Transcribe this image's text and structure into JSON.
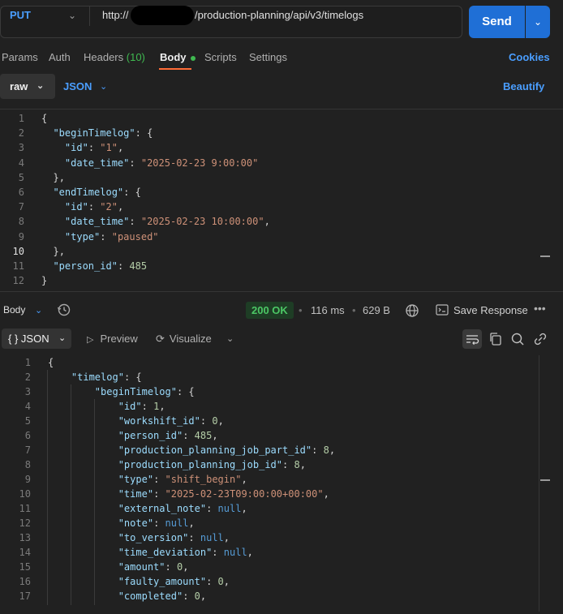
{
  "request": {
    "method": "PUT",
    "url_prefix": "http://",
    "url_path": "/production-planning/api/v3/timelogs",
    "send_label": "Send"
  },
  "request_tabs": {
    "params": "Params",
    "auth": "Auth",
    "headers": "Headers",
    "headers_count": "(10)",
    "body": "Body",
    "scripts": "Scripts",
    "settings": "Settings",
    "cookies": "Cookies"
  },
  "body_options": {
    "mode": "raw",
    "language": "JSON",
    "beautify": "Beautify"
  },
  "request_body_lines": [
    "{",
    "  \"beginTimelog\": {",
    "    \"id\": \"1\",",
    "    \"date_time\": \"2025-02-23 9:00:00\"",
    "  },",
    "  \"endTimelog\": {",
    "    \"id\": \"2\",",
    "    \"date_time\": \"2025-02-23 10:00:00\",",
    "    \"type\": \"paused\"",
    "  },",
    "  \"person_id\": 485",
    "}"
  ],
  "request_current_line": 10,
  "response": {
    "section_label": "Body",
    "status": "200 OK",
    "time": "116 ms",
    "size": "629 B",
    "save_label": "Save Response",
    "more": "•••",
    "format_icon": "{ }",
    "format": "JSON",
    "preview": "Preview",
    "visualize": "Visualize"
  },
  "response_body_lines": [
    "{",
    "    \"timelog\": {",
    "        \"beginTimelog\": {",
    "            \"id\": 1,",
    "            \"workshift_id\": 0,",
    "            \"person_id\": 485,",
    "            \"production_planning_job_part_id\": 8,",
    "            \"production_planning_job_id\": 8,",
    "            \"type\": \"shift_begin\",",
    "            \"time\": \"2025-02-23T09:00:00+00:00\",",
    "            \"external_note\": null,",
    "            \"note\": null,",
    "            \"to_version\": null,",
    "            \"time_deviation\": null,",
    "            \"amount\": 0,",
    "            \"faulty_amount\": 0,",
    "            \"completed\": 0,"
  ],
  "icons": {
    "method_dropdown": "chevron-down-icon",
    "history": "history-icon",
    "globe": "globe-icon",
    "save": "save-response-icon",
    "wrap": "word-wrap-icon",
    "copy": "copy-icon",
    "search": "search-icon",
    "link": "link-icon"
  },
  "colors": {
    "accent": "#1f6fd6",
    "link": "#4a9eff",
    "active_tab_underline": "#ff6c37",
    "status_ok": "#4cc765"
  }
}
